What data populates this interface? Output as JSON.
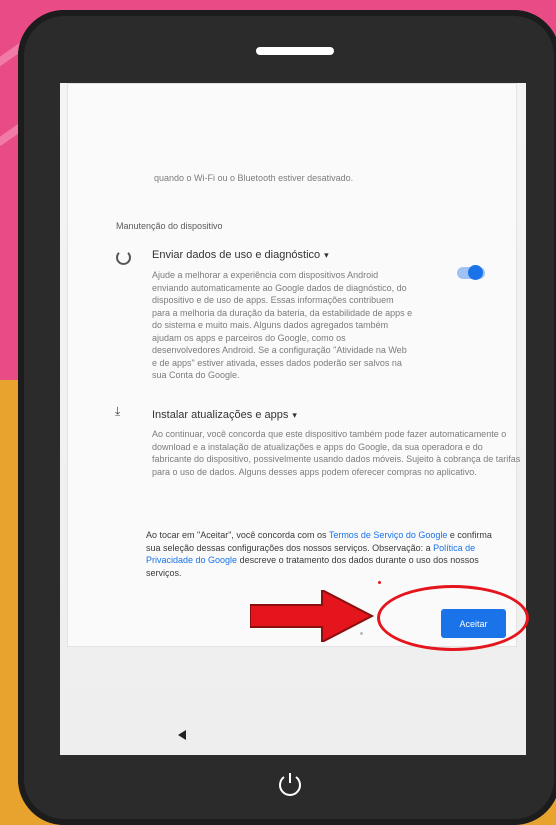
{
  "background": {
    "pink": "#e94b86",
    "orange": "#e8a32e"
  },
  "screen": {
    "top_line": "quando o Wi-Fi ou o Bluetooth estiver desativado.",
    "section_title": "Manutenção do dispositivo",
    "usage": {
      "icon": "circle-progress-icon",
      "title": "Enviar dados de uso e diagnóstico",
      "chevron": "▾",
      "description": "Ajude a melhorar a experiência com dispositivos Android enviando automaticamente ao Google dados de diagnóstico, do dispositivo e de uso de apps. Essas informações contribuem para a melhoria da duração da bateria, da estabilidade de apps e do sistema e muito mais. Alguns dados agregados também ajudam os apps e parceiros do Google, como os desenvolvedores Android. Se a configuração \"Atividade na Web e de apps\" estiver ativada, esses dados poderão ser salvos na sua Conta do Google.",
      "toggle_on": true
    },
    "install": {
      "icon": "download-icon",
      "title": "Instalar atualizações e apps",
      "chevron": "▾",
      "description": "Ao continuar, você concorda que este dispositivo também pode fazer automaticamente o download e a instalação de atualizações e apps do Google, da sua operadora e do fabricante do dispositivo, possivelmente usando dados móveis. Sujeito à cobrança de tarifas para o uso de dados. Alguns desses apps podem oferecer compras no aplicativo."
    },
    "consent": {
      "part1": "Ao tocar em \"Aceitar\", você concorda com os ",
      "link_terms": "Termos de Serviço do Google",
      "part2": " e confirma sua seleção dessas configurações dos nossos serviços. Observação: a ",
      "link_privacy": "Política de Privacidade do Google",
      "part3": " descreve o tratamento dos dados durante o uso dos nossos serviços."
    },
    "accept_label": "Aceitar"
  },
  "annotation": {
    "highlight_color": "#e4151c"
  }
}
